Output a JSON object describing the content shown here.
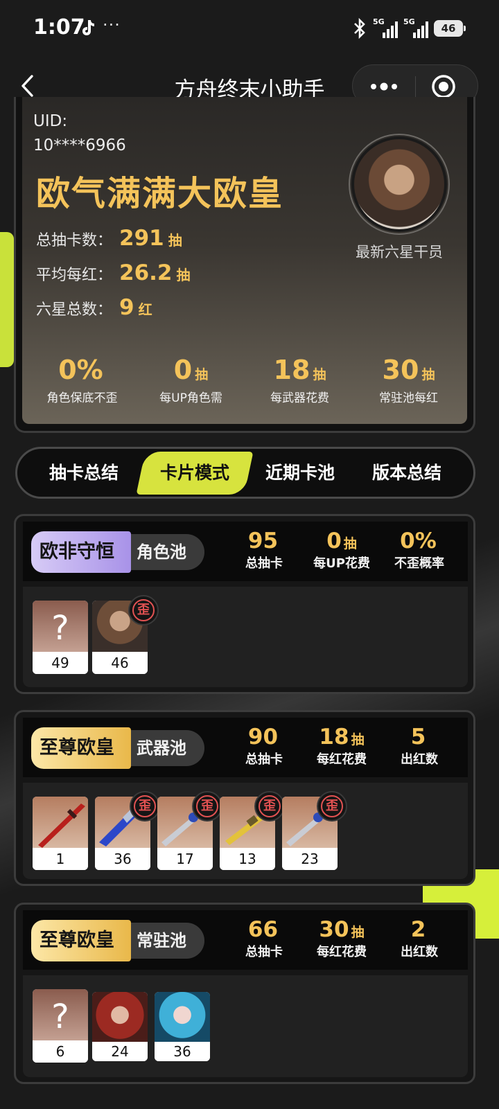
{
  "status_bar": {
    "time": "1:07",
    "more": "···",
    "signal_1": "5G",
    "signal_2": "5G",
    "battery": "46"
  },
  "nav": {
    "title": "方舟终末小助手"
  },
  "profile": {
    "uid_label": "UID:",
    "uid_value": "10****6966",
    "rank_title": "欧气满满大欧皇",
    "total_pulls_label": "总抽卡数：",
    "total_pulls": "291",
    "avg_per_six_label": "平均每红：",
    "avg_per_six": "26.2",
    "six_star_count_label": "六星总数：",
    "six_star_count": "9",
    "unit_pull": "抽",
    "unit_red": "红",
    "latest_six_label": "最新六星干员",
    "bottom_stats": [
      {
        "value": "0%",
        "unit": "",
        "label": "角色保底不歪"
      },
      {
        "value": "0",
        "unit": "抽",
        "label": "每UP角色需"
      },
      {
        "value": "18",
        "unit": "抽",
        "label": "每武器花费"
      },
      {
        "value": "30",
        "unit": "抽",
        "label": "常驻池每红"
      }
    ]
  },
  "tabs": [
    {
      "label": "抽卡总结"
    },
    {
      "label": "卡片模式"
    },
    {
      "label": "近期卡池"
    },
    {
      "label": "版本总结"
    }
  ],
  "pools": [
    {
      "tier": "欧非守恒",
      "name": "角色池",
      "stats": [
        {
          "value": "95",
          "unit": "",
          "label": "总抽卡"
        },
        {
          "value": "0",
          "unit": "抽",
          "label": "每UP花费"
        },
        {
          "value": "0%",
          "unit": "",
          "label": "不歪概率"
        }
      ],
      "cards": [
        "49",
        "46"
      ]
    },
    {
      "tier": "至尊欧皇",
      "name": "武器池",
      "stats": [
        {
          "value": "90",
          "unit": "",
          "label": "总抽卡"
        },
        {
          "value": "18",
          "unit": "抽",
          "label": "每红花费"
        },
        {
          "value": "5",
          "unit": "",
          "label": "出红数"
        }
      ],
      "cards": [
        "1",
        "36",
        "17",
        "13",
        "23"
      ]
    },
    {
      "tier": "至尊欧皇",
      "name": "常驻池",
      "stats": [
        {
          "value": "66",
          "unit": "",
          "label": "总抽卡"
        },
        {
          "value": "30",
          "unit": "抽",
          "label": "每红花费"
        },
        {
          "value": "2",
          "unit": "",
          "label": "出红数"
        }
      ],
      "cards": [
        "6",
        "24",
        "36"
      ]
    }
  ],
  "card_unknown": "?",
  "badge_off_banner": "歪",
  "colors": {
    "accent_gold": "#f4c35a",
    "tab_active": "#d7e33e",
    "badge_red": "#e25252",
    "tier_purple": "#a892e8",
    "tier_gold": "#e9b84a"
  }
}
